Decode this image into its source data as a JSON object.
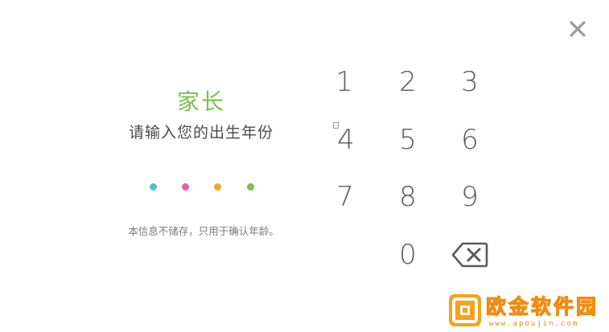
{
  "header": {
    "close_icon": "close-icon"
  },
  "prompt": {
    "title": "家长",
    "subtitle": "请输入您的出生年份",
    "notice": "本信息不储存，只用于确认年龄。"
  },
  "pin_dots": {
    "colors": [
      "#4ec1c4",
      "#f25aa8",
      "#f5a623",
      "#7bc24a"
    ]
  },
  "keypad": {
    "keys": [
      {
        "label": "1",
        "name": "key-1"
      },
      {
        "label": "2",
        "name": "key-2"
      },
      {
        "label": "3",
        "name": "key-3"
      },
      {
        "label": "4",
        "name": "key-4"
      },
      {
        "label": "5",
        "name": "key-5"
      },
      {
        "label": "6",
        "name": "key-6"
      },
      {
        "label": "7",
        "name": "key-7"
      },
      {
        "label": "8",
        "name": "key-8"
      },
      {
        "label": "9",
        "name": "key-9"
      },
      {
        "label": "0",
        "name": "key-0"
      }
    ],
    "backspace_icon": "backspace-icon"
  },
  "watermark": {
    "text": "欧金软件园",
    "url": "www.apoujin.com"
  },
  "colors": {
    "accent_green": "#7bc24a",
    "key_text": "#5a5a5a",
    "watermark_orange": "#f5a21c"
  }
}
